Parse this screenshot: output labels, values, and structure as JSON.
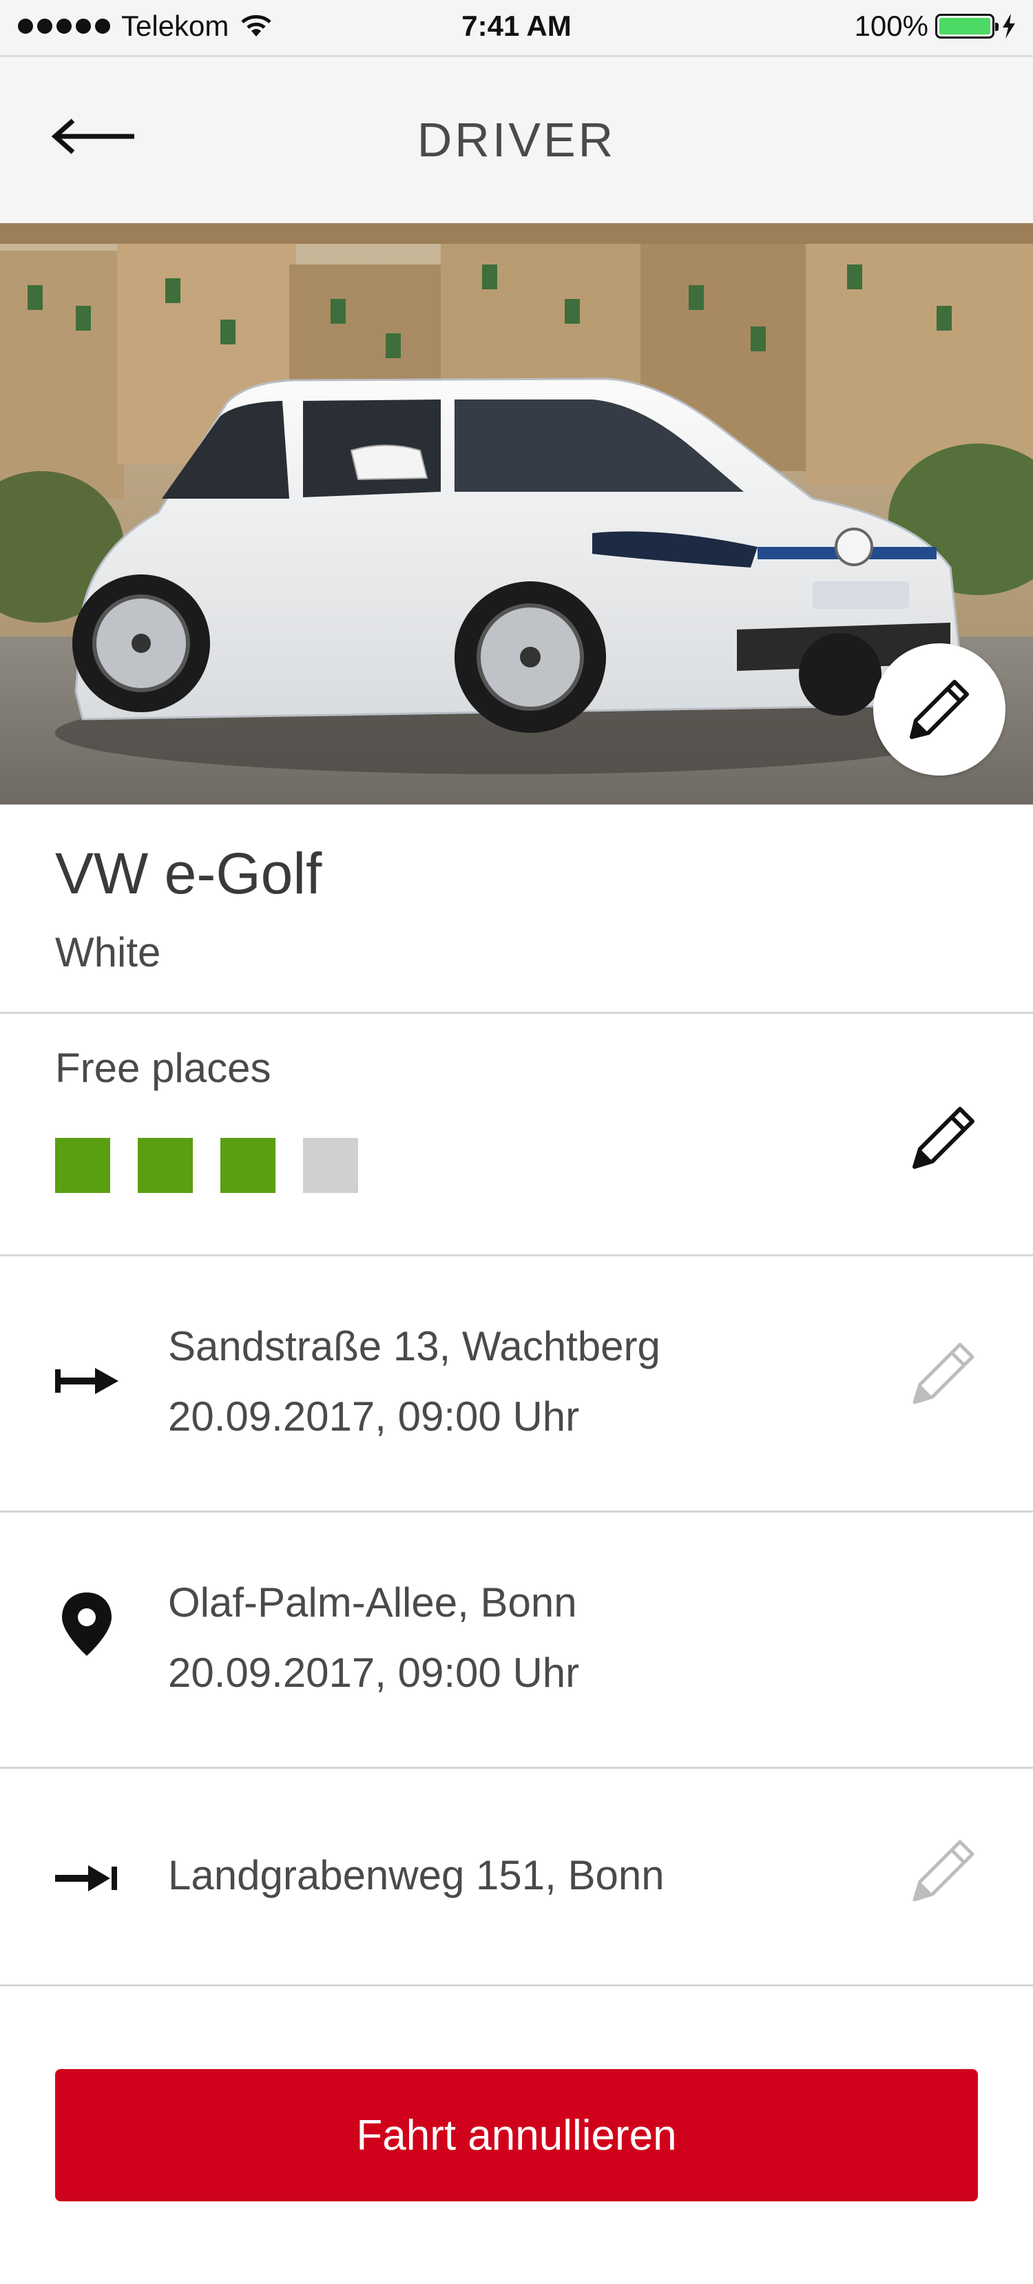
{
  "status_bar": {
    "carrier": "Telekom",
    "time": "7:41 AM",
    "battery": "100%",
    "battery_level": 1.0,
    "icons": [
      "signal-dots-icon",
      "wifi-icon",
      "battery-icon",
      "charging-bolt-icon"
    ]
  },
  "header": {
    "title": "DRIVER",
    "back_icon": "arrow-left-icon"
  },
  "car": {
    "name": "VW e-Golf",
    "color": "White",
    "edit_icon": "pencil-icon"
  },
  "free_places": {
    "label": "Free places",
    "seats": [
      "free",
      "free",
      "free",
      "taken"
    ],
    "free_count": 3,
    "total": 4,
    "colors": {
      "free": "#5a9e12",
      "taken": "#d0d0d0"
    }
  },
  "route": {
    "start": {
      "address": "Sandstraße 13, Wachtberg",
      "datetime": "20.09.2017, 09:00 Uhr",
      "icon": "start-arrow-icon"
    },
    "stop": {
      "address": "Olaf-Palm-Allee, Bonn",
      "datetime": "20.09.2017, 09:00 Uhr",
      "icon": "location-pin-icon"
    },
    "destination": {
      "address": "Landgrabenweg 151, Bonn",
      "icon": "end-arrow-icon"
    }
  },
  "actions": {
    "cancel_label": "Fahrt annullieren"
  },
  "colors": {
    "accent": "#d0021b",
    "header_bg": "#f5f5f5",
    "divider": "#d6d6d6",
    "text": "#3a3a3a"
  }
}
